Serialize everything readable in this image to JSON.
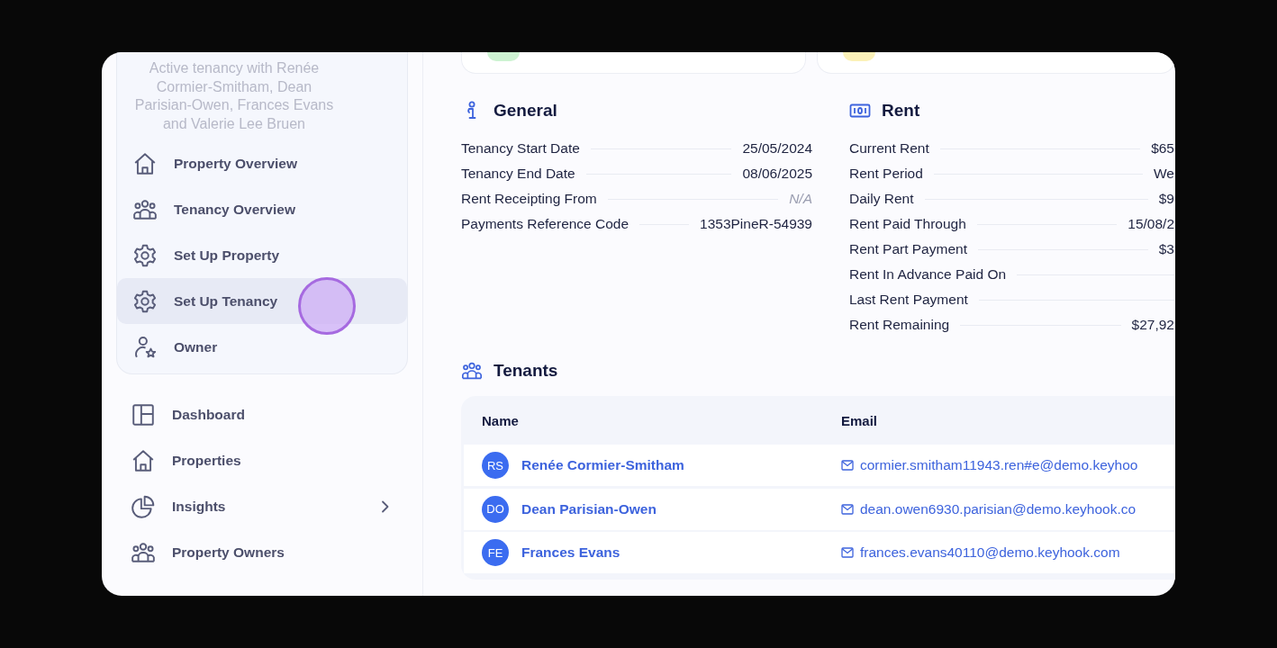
{
  "sidebar": {
    "tenancy_summary": "Active tenancy with Renée Cormier-Smitham, Dean Parisian-Owen, Frances Evans and Valerie Lee Bruen",
    "property_menu": [
      {
        "label": "Property Overview",
        "kind": "house",
        "highlighted": false
      },
      {
        "label": "Tenancy Overview",
        "kind": "people",
        "highlighted": false
      },
      {
        "label": "Set Up Property",
        "kind": "gear",
        "highlighted": false
      },
      {
        "label": "Set Up Tenancy",
        "kind": "gear",
        "highlighted": true
      },
      {
        "label": "Owner",
        "kind": "owner",
        "highlighted": false
      }
    ],
    "main_menu": [
      {
        "label": "Dashboard",
        "kind": "layout",
        "expandable": false
      },
      {
        "label": "Properties",
        "kind": "house",
        "expandable": false
      },
      {
        "label": "Insights",
        "kind": "pie",
        "expandable": true
      },
      {
        "label": "Property Owners",
        "kind": "people",
        "expandable": false
      }
    ]
  },
  "general": {
    "title": "General",
    "rows": [
      {
        "label": "Tenancy Start Date",
        "value": "25/05/2024",
        "muted": false
      },
      {
        "label": "Tenancy End Date",
        "value": "08/06/2025",
        "muted": false
      },
      {
        "label": "Rent Receipting From",
        "value": "N/A",
        "muted": true
      },
      {
        "label": "Payments Reference Code",
        "value": "1353PineR-54939",
        "muted": false
      }
    ]
  },
  "rent": {
    "title": "Rent",
    "rows": [
      {
        "label": "Current Rent",
        "value": "$65"
      },
      {
        "label": "Rent Period",
        "value": "We"
      },
      {
        "label": "Daily Rent",
        "value": "$9"
      },
      {
        "label": "Rent Paid Through",
        "value": "15/08/2"
      },
      {
        "label": "Rent Part Payment",
        "value": "$3"
      },
      {
        "label": "Rent In Advance Paid On"
      },
      {
        "label": "Last Rent Payment"
      },
      {
        "label": "Rent Remaining",
        "value": "$27,92"
      }
    ]
  },
  "tenants": {
    "title": "Tenants",
    "columns": [
      "Name",
      "Email"
    ],
    "rows": [
      {
        "initials": "RS",
        "name": "Renée Cormier-Smitham",
        "email": "cormier.smitham11943.ren#e@demo.keyhoo"
      },
      {
        "initials": "DO",
        "name": "Dean Parisian-Owen",
        "email": "dean.owen6930.parisian@demo.keyhook.co"
      },
      {
        "initials": "FE",
        "name": "Frances Evans",
        "email": "frances.evans40110@demo.keyhook.com"
      }
    ]
  }
}
